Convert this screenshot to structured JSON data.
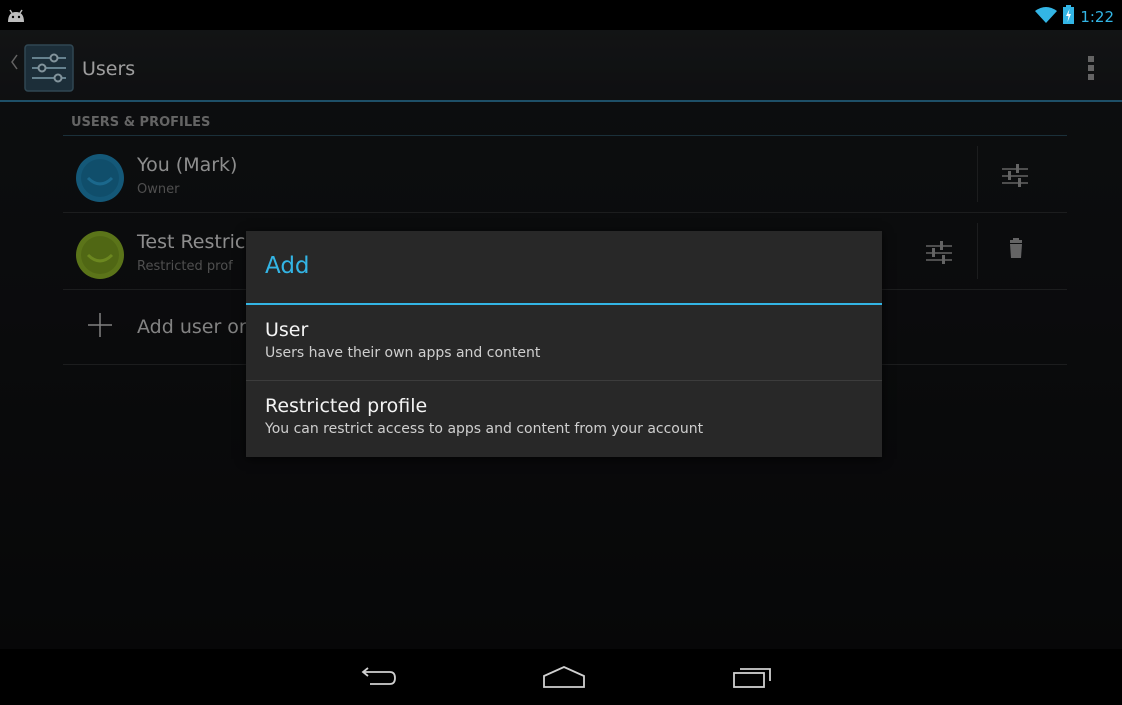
{
  "status_bar": {
    "time": "1:22",
    "icons": [
      "android-debug-icon",
      "wifi-icon",
      "battery-charging-icon"
    ]
  },
  "action_bar": {
    "title": "Users",
    "icons": [
      "back-caret-icon",
      "settings-app-icon",
      "overflow-menu-icon"
    ]
  },
  "section": {
    "header": "USERS & PROFILES",
    "users": [
      {
        "name": "You (Mark)",
        "subtitle": "Owner",
        "avatar_color": "#1f87b8"
      },
      {
        "name": "Test Restric",
        "subtitle": "Restricted prof",
        "avatar_color": "#8db327"
      }
    ],
    "add_label": "Add user or"
  },
  "dialog": {
    "title": "Add",
    "items": [
      {
        "title": "User",
        "subtitle": "Users have their own apps and content"
      },
      {
        "title": "Restricted profile",
        "subtitle": "You can restrict access to apps and content from your account"
      }
    ]
  },
  "colors": {
    "accent": "#33b5e5",
    "background": "#111214",
    "dialog_background": "#282828"
  },
  "nav_bar": {
    "icons": [
      "back-icon",
      "home-icon",
      "recent-apps-icon"
    ]
  }
}
